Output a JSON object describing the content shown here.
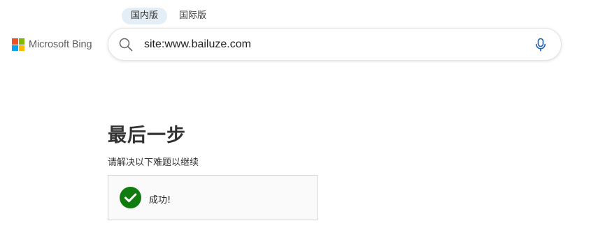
{
  "scope_tabs": [
    {
      "label": "国内版",
      "active": true
    },
    {
      "label": "国际版",
      "active": false
    }
  ],
  "logo": {
    "text": "Microsoft Bing",
    "colors": [
      "#f25022",
      "#7fba00",
      "#00a4ef",
      "#ffb900"
    ]
  },
  "search": {
    "value": "site:www.bailuze.com",
    "icon": "search-icon",
    "mic_icon": "microphone-icon",
    "mic_color": "#1a5fb4"
  },
  "challenge": {
    "title": "最后一步",
    "subtitle": "请解决以下难题以继续",
    "status_text": "成功!",
    "status_icon": "checkmark-icon",
    "status_color": "#107c10"
  }
}
